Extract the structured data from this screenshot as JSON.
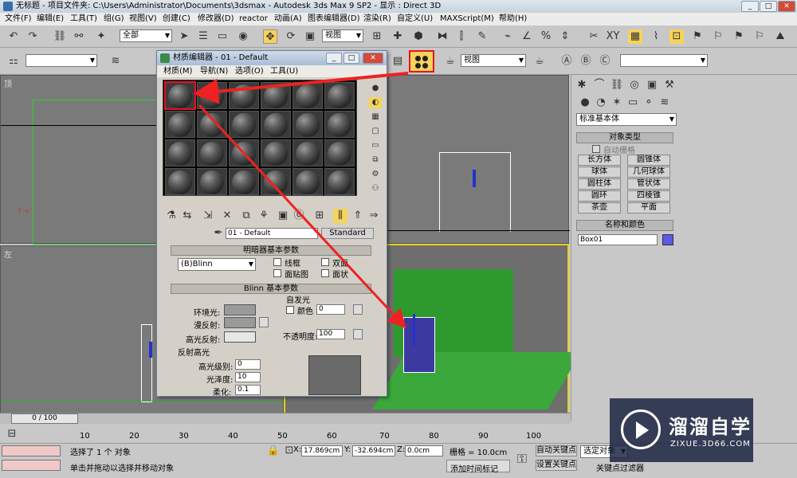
{
  "app": {
    "title": "无标题    - 项目文件夹: C:\\Users\\Administrator\\Documents\\3dsmax    - Autodesk 3ds Max 9 SP2    - 显示 : Direct 3D"
  },
  "menu": [
    "文件(F)",
    "编辑(E)",
    "工具(T)",
    "组(G)",
    "视图(V)",
    "创建(C)",
    "修改器(D)",
    "reactor",
    "动画(A)",
    "图表编辑器(D)",
    "渲染(R)",
    "自定义(U)",
    "MAXScript(M)",
    "帮助(H)"
  ],
  "toolbar": {
    "selection_filter": "全部",
    "ref_coord": "视图",
    "view_combo": "视图"
  },
  "viewports": {
    "top_label": "顶",
    "left_label": "左"
  },
  "material_editor": {
    "title": "材质编辑器 - 01 - Default",
    "menu": [
      "材质(M)",
      "导航(N)",
      "选项(O)",
      "工具(U)"
    ],
    "material_name": "01 - Default",
    "material_type": "Standard",
    "shader_rollout": "明暗器基本参数",
    "shader": "(B)Blinn",
    "wire": "线框",
    "two_sided": "双面",
    "face_map": "面贴图",
    "faceted": "面状",
    "blinn_rollout": "Blinn 基本参数",
    "self_illum": "自发光",
    "color": "颜色",
    "color_val": "0",
    "ambient": "环境光:",
    "diffuse": "漫反射:",
    "specular": "高光反射:",
    "opacity": "不透明度:",
    "opacity_val": "100",
    "spec_highlights": "反射高光",
    "spec_level": "高光级别:",
    "spec_level_val": "0",
    "glossiness": "光泽度:",
    "glossiness_val": "10",
    "soften": "柔化:",
    "soften_val": "0.1"
  },
  "command_panel": {
    "category": "标准基本体",
    "object_type": "对象类型",
    "autogrid": "自动栅格",
    "buttons": [
      "长方体",
      "圆锥体",
      "球体",
      "几何球体",
      "圆柱体",
      "管状体",
      "圆环",
      "四棱锥",
      "茶壶",
      "平面"
    ],
    "name_color": "名称和颜色",
    "object_name": "Box01",
    "object_color": "#5a5ae6"
  },
  "timeline": {
    "frame": "0 / 100",
    "ticks": [
      "0",
      "10",
      "20",
      "30",
      "40",
      "50",
      "60",
      "70",
      "80",
      "90",
      "100"
    ]
  },
  "status": {
    "selected": "选择了 1 个 对象",
    "prompt": "单击并拖动以选择并移动对象",
    "x": "17.869cm",
    "y": "-32.694cm",
    "z": "0.0cm",
    "grid": "栅格 = 10.0cm",
    "auto_key": "自动关键点",
    "set_key": "设置关键点",
    "selected_set": "选定对象",
    "add_time_tag": "添加时间标记",
    "key_filters": "关键点过滤器"
  },
  "watermark": {
    "brand": "溜溜自学",
    "url": "ZIXUE.3D66.COM"
  }
}
